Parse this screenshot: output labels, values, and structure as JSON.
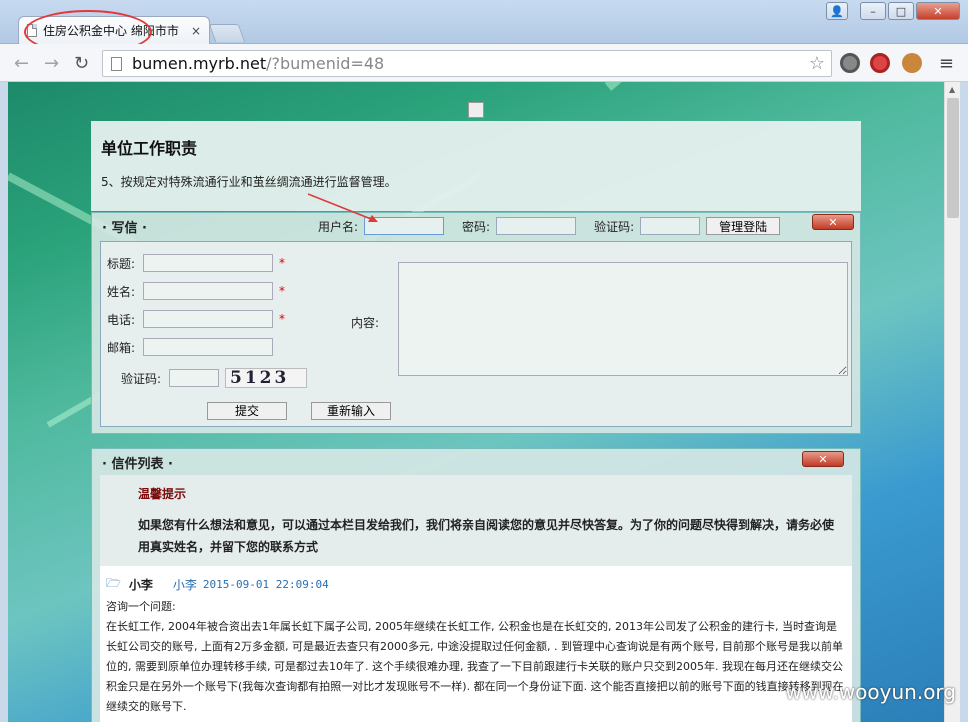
{
  "browser": {
    "tab_title": "住房公积金中心 绵阳市市",
    "tab_close": "×",
    "url_host": "bumen.myrb.net",
    "url_path": "/?bumenid=48",
    "window_controls": [
      "–",
      "□",
      "✕"
    ]
  },
  "duty": {
    "title": "单位工作职责",
    "text": "5、按规定对特殊流通行业和茧丝绸流通进行监督管理。"
  },
  "write": {
    "title": "· 写信 ·",
    "username_label": "用户名:",
    "password_label": "密码:",
    "captcha_label": "验证码:",
    "login_button": "管理登陆",
    "close_label": "✕",
    "form": {
      "subject_label": "标题:",
      "name_label": "姓名:",
      "phone_label": "电话:",
      "email_label": "邮箱:",
      "captcha_label": "验证码:",
      "content_label": "内容:",
      "required_mark": "*",
      "captcha_text": "5123",
      "submit_button": "提交",
      "reset_button": "重新输入"
    }
  },
  "list": {
    "title": "· 信件列表 ·",
    "close_label": "✕",
    "notice_title": "温馨提示",
    "notice_body": "如果您有什么想法和意见，可以通过本栏目发给我们，我们将亲自阅读您的意见并尽快答复。为了你的问题尽快得到解决，请务必使用真实姓名，并留下您的联系方式",
    "messages": [
      {
        "author": "小李",
        "name": "小李",
        "time": "2015-09-01 22:09:04",
        "subject": "咨询一个问题:",
        "body": "在长虹工作, 2004年被合资出去1年属长虹下属子公司, 2005年继续在长虹工作, 公积金也是在长虹交的, 2013年公司发了公积金的建行卡, 当时查询是长虹公司交的账号, 上面有2万多金额, 可是最近去查只有2000多元, 中途没提取过任何金额, . 到管理中心查询说是有两个账号, 目前那个账号是我以前单位的, 需要到原单位办理转移手续, 可是都过去10年了. 这个手续很难办理, 我查了一下目前跟建行卡关联的账户只交到2005年. 我现在每月还在继续交公积金只是在另外一个账号下(我每次查询都有拍照一对比才发现账号不一样). 都在同一个身份证下面. 这个能否直接把以前的账号下面的钱直接转移到现在继续交的账号下."
      }
    ]
  },
  "watermark": "www.wooyun.org"
}
